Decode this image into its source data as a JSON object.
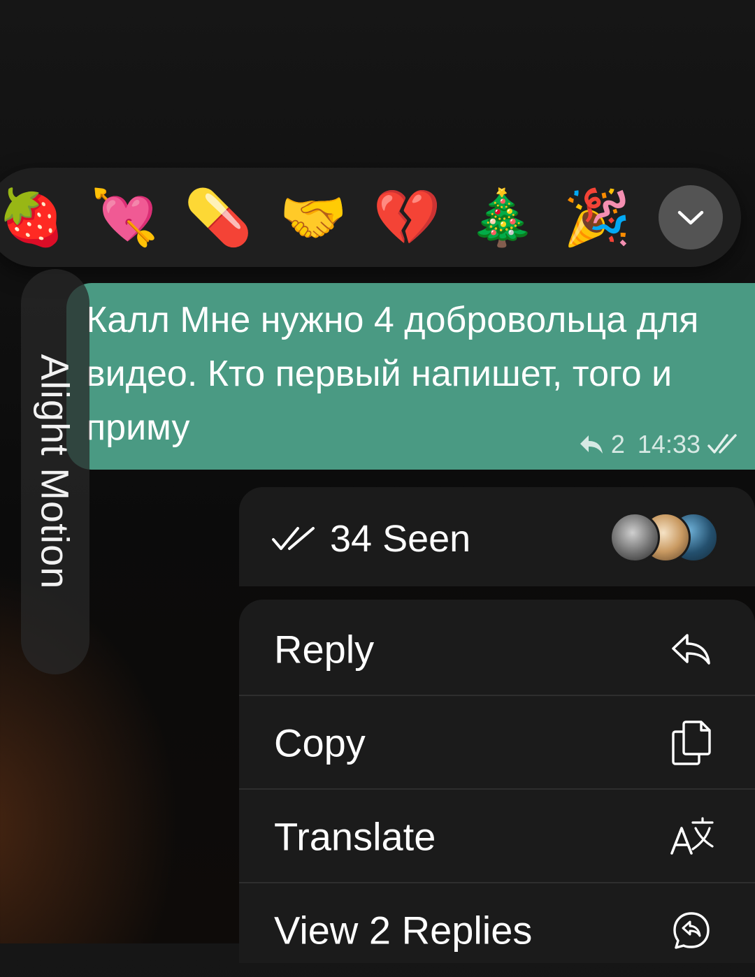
{
  "watermark": {
    "text": "Alight Motion"
  },
  "reactions": [
    {
      "name": "strawberry",
      "glyph": "🍓"
    },
    {
      "name": "heart-with-arrow",
      "glyph": "💘"
    },
    {
      "name": "pill",
      "glyph": "💊"
    },
    {
      "name": "handshake",
      "glyph": "🤝"
    },
    {
      "name": "broken-heart",
      "glyph": "💔"
    },
    {
      "name": "christmas-tree",
      "glyph": "🎄"
    },
    {
      "name": "party-popper",
      "glyph": "🎉"
    }
  ],
  "expand_icon": "chevron-down-icon",
  "message": {
    "text": "Калл Мне нужно 4 добровольца для видео. Кто первый напишет, того и приму",
    "reply_count": "2",
    "time": "14:33",
    "status": "read",
    "bubble_color": "#4a9a83"
  },
  "seen": {
    "label": "34 Seen",
    "avatars": [
      "avatar-1",
      "avatar-2",
      "avatar-3"
    ]
  },
  "menu": [
    {
      "label": "Reply",
      "icon": "reply-icon"
    },
    {
      "label": "Copy",
      "icon": "copy-icon"
    },
    {
      "label": "Translate",
      "icon": "translate-icon"
    },
    {
      "label": "View 2 Replies",
      "icon": "view-replies-icon"
    }
  ]
}
